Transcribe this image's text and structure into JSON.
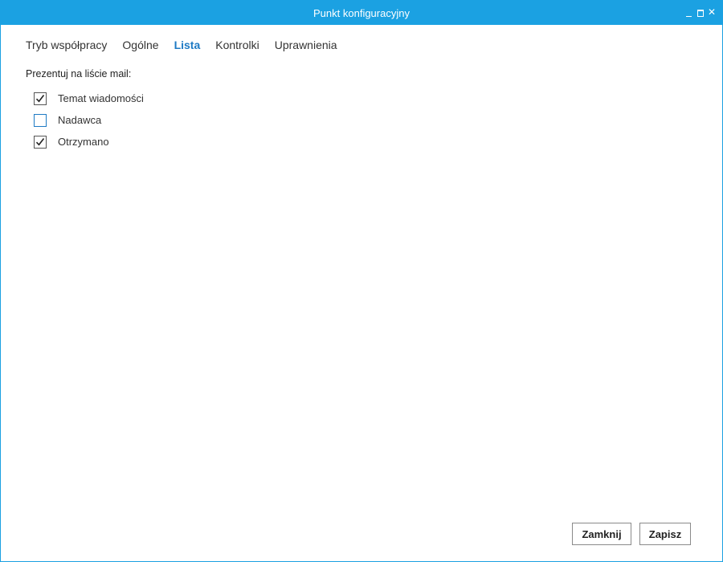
{
  "window": {
    "title": "Punkt konfiguracyjny",
    "controls": [
      "minimize-icon",
      "maximize-icon",
      "close-icon"
    ],
    "close_glyph": "✕"
  },
  "tabs": [
    {
      "label": "Tryb współpracy",
      "active": false
    },
    {
      "label": "Ogólne",
      "active": false
    },
    {
      "label": "Lista",
      "active": true
    },
    {
      "label": "Kontrolki",
      "active": false
    },
    {
      "label": "Uprawnienia",
      "active": false
    }
  ],
  "list_section": {
    "heading": "Prezentuj na liście mail:",
    "options": [
      {
        "label": "Temat wiadomości",
        "checked": true
      },
      {
        "label": "Nadawca",
        "checked": false
      },
      {
        "label": "Otrzymano",
        "checked": true
      }
    ]
  },
  "footer": {
    "close_label": "Zamknij",
    "save_label": "Zapisz"
  },
  "colors": {
    "accent": "#1ba1e2",
    "active_tab": "#1e7ac4",
    "text": "#333333"
  }
}
